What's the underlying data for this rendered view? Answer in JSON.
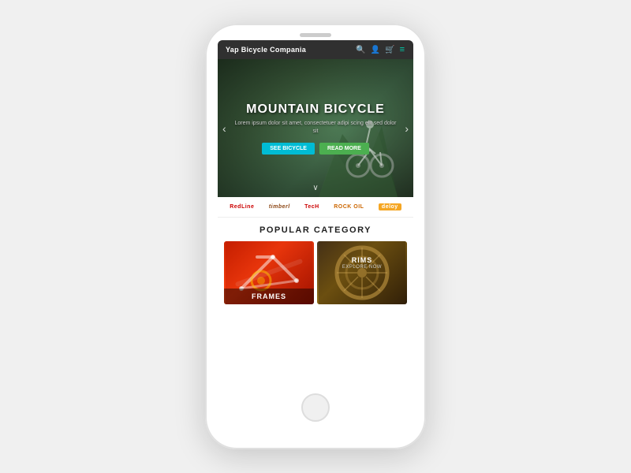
{
  "phone": {
    "speaker_label": "speaker"
  },
  "navbar": {
    "brand": "Yap Bicycle Compania",
    "search_icon": "🔍",
    "user_icon": "👤",
    "cart_icon": "🛒",
    "menu_icon": "≡"
  },
  "hero": {
    "title": "MOUNTAIN BICYCLE",
    "subtitle": "Lorem ipsum dolor sit amet, consectetuer adipi\nscing elit sed dolor sit",
    "btn_see": "SEE BICYCLE",
    "btn_read": "READ MORE",
    "arrow_left": "‹",
    "arrow_right": "›",
    "scroll_down": "∨"
  },
  "brands": [
    {
      "name": "RedLine",
      "class": "brand-redline"
    },
    {
      "name": "timberl",
      "class": "brand-timber"
    },
    {
      "name": "TecH",
      "class": "brand-techn"
    },
    {
      "name": "ROCK OIL",
      "class": "brand-rockol"
    },
    {
      "name": "deloy",
      "class": "brand-deloy"
    }
  ],
  "popular": {
    "section_title": "POPULAR CATEGORY",
    "categories": [
      {
        "id": "frames",
        "name": "FRAMES",
        "explore": ""
      },
      {
        "id": "rims",
        "name": "RIMS",
        "explore": "EXPLORE NOW"
      }
    ]
  }
}
